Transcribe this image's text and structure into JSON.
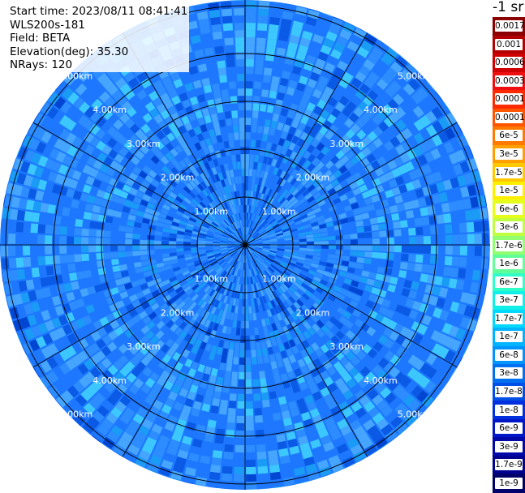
{
  "info": {
    "start_time": "Start time: 2023/08/11 08:41:41",
    "instrument": "WLS200s-181",
    "field": "Field: BETA",
    "elevation": "Elevation(deg): 35.30",
    "nrays": "NRays: 120"
  },
  "colorbar": {
    "units": "-1 sr",
    "entries": [
      {
        "label": "0.0017",
        "color": "#8b0000"
      },
      {
        "label": "0.001",
        "color": "#b30000"
      },
      {
        "label": "0.0006",
        "color": "#d00000"
      },
      {
        "label": "0.0003",
        "color": "#ee1010"
      },
      {
        "label": "0.00017",
        "color": "#ff2a00"
      },
      {
        "label": "0.0001",
        "color": "#ff5500"
      },
      {
        "label": "6e-5",
        "color": "#ff7a00"
      },
      {
        "label": "3e-5",
        "color": "#ffa000"
      },
      {
        "label": "1.7e-5",
        "color": "#ffc800"
      },
      {
        "label": "1e-5",
        "color": "#ffee00"
      },
      {
        "label": "6e-6",
        "color": "#e6ff1a"
      },
      {
        "label": "3e-6",
        "color": "#c0ff40"
      },
      {
        "label": "1.7e-6",
        "color": "#90ff70"
      },
      {
        "label": "1e-6",
        "color": "#60ff98"
      },
      {
        "label": "6e-7",
        "color": "#30ffc8"
      },
      {
        "label": "3e-7",
        "color": "#10f0e8"
      },
      {
        "label": "1.7e-7",
        "color": "#00d8ff"
      },
      {
        "label": "1e-7",
        "color": "#00b4ff"
      },
      {
        "label": "6e-8",
        "color": "#0094ff"
      },
      {
        "label": "3e-8",
        "color": "#0070f0"
      },
      {
        "label": "1.7e-8",
        "color": "#0050e8"
      },
      {
        "label": "1e-8",
        "color": "#0030dd"
      },
      {
        "label": "6e-9",
        "color": "#0018c8"
      },
      {
        "label": "3e-9",
        "color": "#0008a8"
      },
      {
        "label": "1.7e-9",
        "color": "#000090"
      },
      {
        "label": "1e-9",
        "color": "#00006a"
      }
    ]
  },
  "ppi": {
    "range_ring_labels": [
      "1.00km",
      "2.00km",
      "3.00km",
      "4.00km",
      "5.00km"
    ],
    "n_rays": 120,
    "field_colors": [
      "#1e78ff",
      "#2d8cff",
      "#46a5ff",
      "#0a5ae6",
      "#1a9bf5",
      "#3cc8ff",
      "#0046d2"
    ]
  }
}
